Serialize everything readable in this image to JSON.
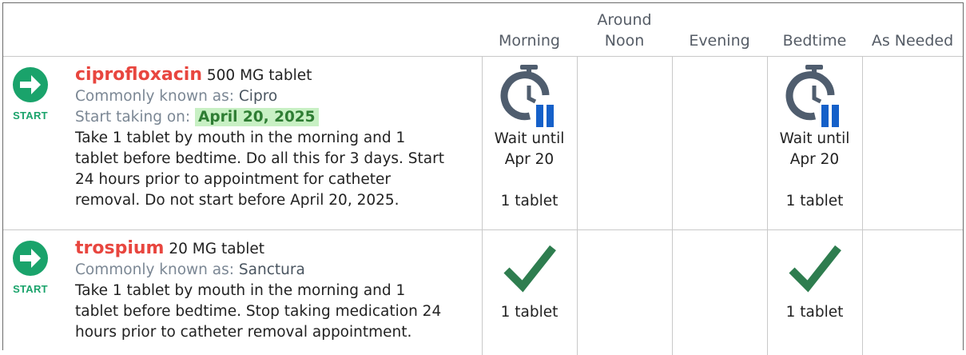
{
  "header": {
    "columns": [
      "Morning",
      "Around Noon",
      "Evening",
      "Bedtime",
      "As Needed"
    ]
  },
  "colors": {
    "drug_name": "#e8463f",
    "start_green": "#1aa36b",
    "check_green": "#2e7d4f",
    "timer_slate": "#4f5d6e",
    "timer_blue": "#1560c9",
    "date_highlight": "#c8f0c4"
  },
  "medications": [
    {
      "start_label": "START",
      "start_icon": "arrow-right-circle-icon",
      "name": "ciprofloxacin",
      "strength": "500 MG tablet",
      "known_as_label": "Commonly known as:",
      "known_as": "Cipro",
      "start_taking_label": "Start taking on:",
      "start_taking_date": "April 20, 2025",
      "instructions_line1": "Take 1 tablet by mouth in the morning and 1",
      "instructions_line2": "tablet before bedtime. Do all this for 3 days. Start",
      "instructions_line3": "24 hours prior to appointment for catheter",
      "instructions_line4": "removal. Do not start before April 20, 2025.",
      "morning": {
        "icon": "timer-pause-icon",
        "wait_line1": "Wait until",
        "wait_line2": "Apr 20",
        "dose": "1 tablet"
      },
      "bedtime": {
        "icon": "timer-pause-icon",
        "wait_line1": "Wait until",
        "wait_line2": "Apr 20",
        "dose": "1 tablet"
      }
    },
    {
      "start_label": "START",
      "start_icon": "arrow-right-circle-icon",
      "name": "trospium",
      "strength": "20 MG tablet",
      "known_as_label": "Commonly known as:",
      "known_as": "Sanctura",
      "instructions_line1": "Take 1 tablet by mouth in the morning and 1",
      "instructions_line2": "tablet before bedtime. Stop taking medication 24",
      "instructions_line3": "hours prior to catheter removal appointment.",
      "morning": {
        "icon": "checkmark-icon",
        "dose": "1 tablet"
      },
      "bedtime": {
        "icon": "checkmark-icon",
        "dose": "1 tablet"
      }
    }
  ]
}
